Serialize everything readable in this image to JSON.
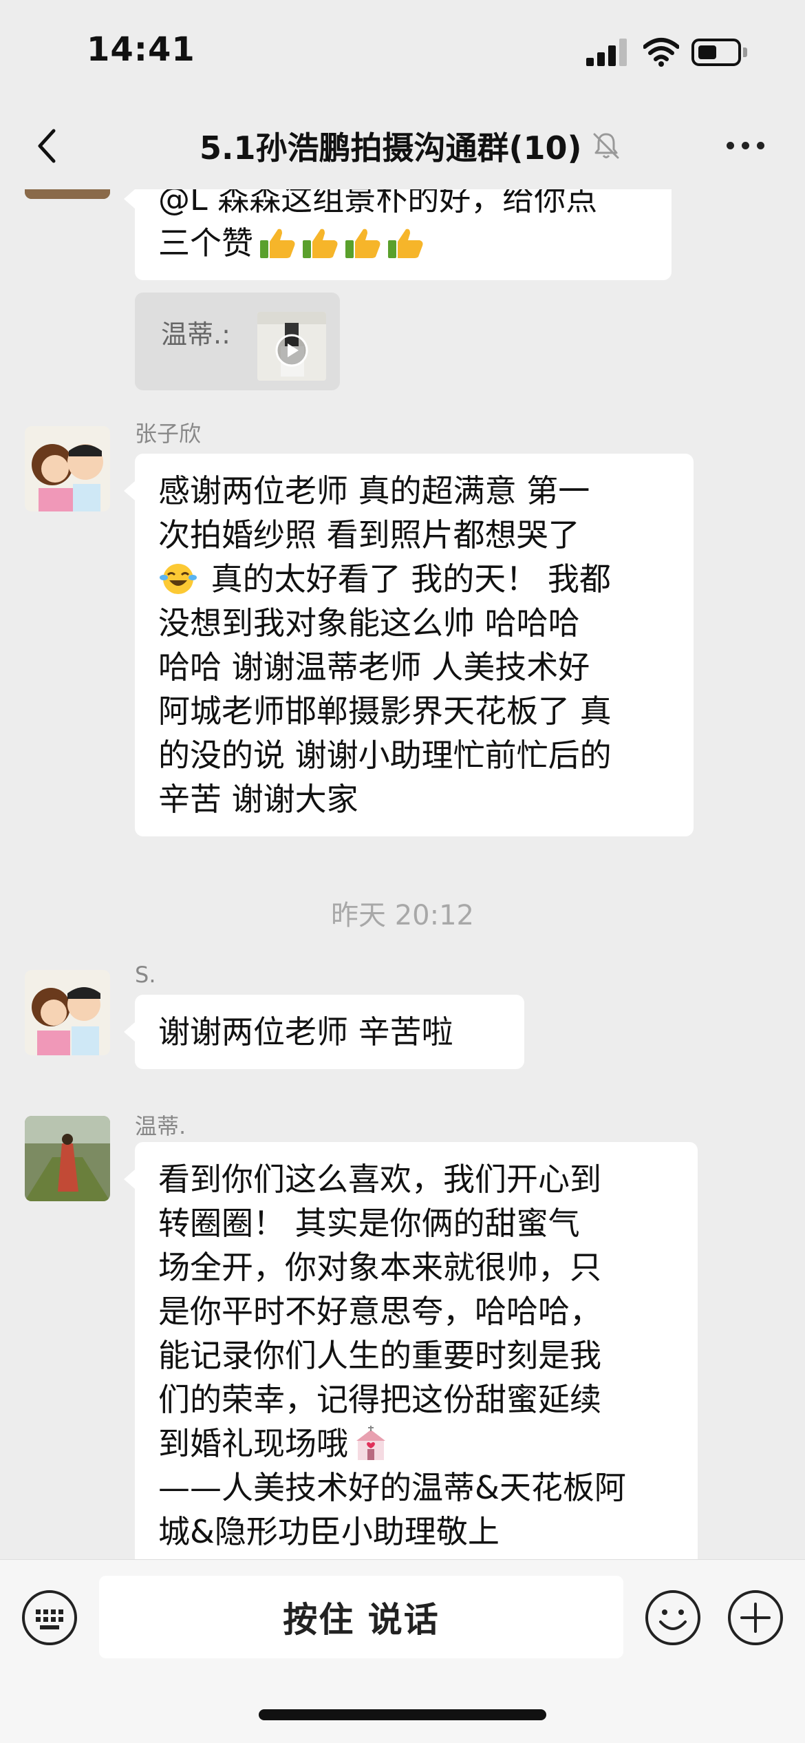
{
  "status_bar": {
    "time": "14:41"
  },
  "nav": {
    "title": "5.1孙浩鹏拍摄沟通群(10)"
  },
  "messages": {
    "m1": {
      "lines": [
        "@L 森森这组景朴的好，给你点",
        "三个赞"
      ]
    },
    "m2": {
      "label": "温蒂.:"
    },
    "m3": {
      "sender": "张子欣",
      "lines": [
        "感谢两位老师 真的超满意 第一",
        "次拍婚纱照 看到照片都想哭了",
        " 真的太好看了 我的天！ 我都",
        "没想到我对象能这么帅 哈哈哈",
        "哈哈 谢谢温蒂老师 人美技术好",
        "阿城老师邯郸摄影界天花板了 真",
        "的没的说 谢谢小助理忙前忙后的",
        "辛苦 谢谢大家"
      ]
    },
    "timestamp": "昨天 20:12",
    "m4": {
      "sender": "S.",
      "text": "谢谢两位老师 辛苦啦"
    },
    "m5": {
      "sender": "温蒂.",
      "lines": [
        "看到你们这么喜欢，我们开心到",
        "转圈圈！ 其实是你俩的甜蜜气",
        "场全开，你对象本来就很帅，只",
        "是你平时不好意思夸，哈哈哈，",
        "能记录你们人生的重要时刻是我",
        "们的荣幸，记得把这份甜蜜延续",
        "到婚礼现场哦",
        "——人美技术好的温蒂&天花板阿",
        "城&隐形功臣小助理敬上"
      ]
    }
  },
  "input_bar": {
    "talk_label": "按住 说话"
  },
  "icons": [
    "back-icon",
    "mute-icon",
    "more-icon",
    "keyboard-icon",
    "emoji-icon",
    "plus-icon",
    "thumbs-up-icon",
    "laughing-tears-icon",
    "wedding-chapel-icon",
    "video-play-icon"
  ],
  "colors": {
    "background": "#ededed",
    "bubble": "#ffffff",
    "timestamp": "#a8a8a8",
    "name": "#888888"
  }
}
